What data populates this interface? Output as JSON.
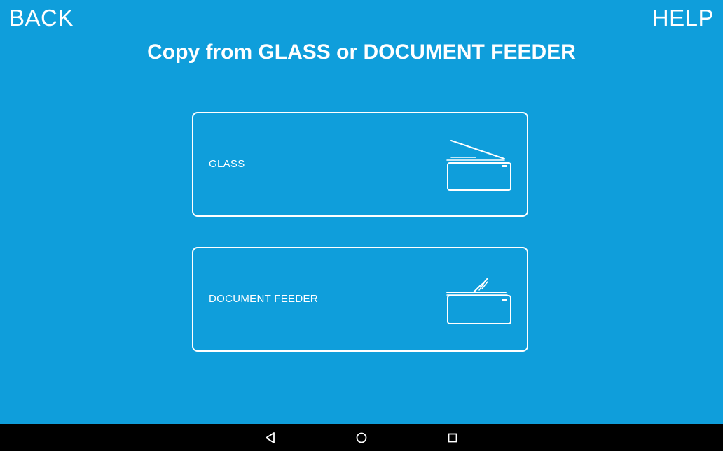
{
  "header": {
    "back_label": "BACK",
    "help_label": "HELP",
    "title": "Copy from GLASS or DOCUMENT FEEDER"
  },
  "options": [
    {
      "label": "GLASS",
      "icon": "scanner-glass-icon"
    },
    {
      "label": "DOCUMENT FEEDER",
      "icon": "document-feeder-icon"
    }
  ],
  "navbar": {
    "icons": [
      "nav-back-icon",
      "nav-home-icon",
      "nav-recents-icon"
    ]
  },
  "colors": {
    "background": "#0f9edb",
    "foreground": "#ffffff",
    "navbar": "#000000"
  }
}
